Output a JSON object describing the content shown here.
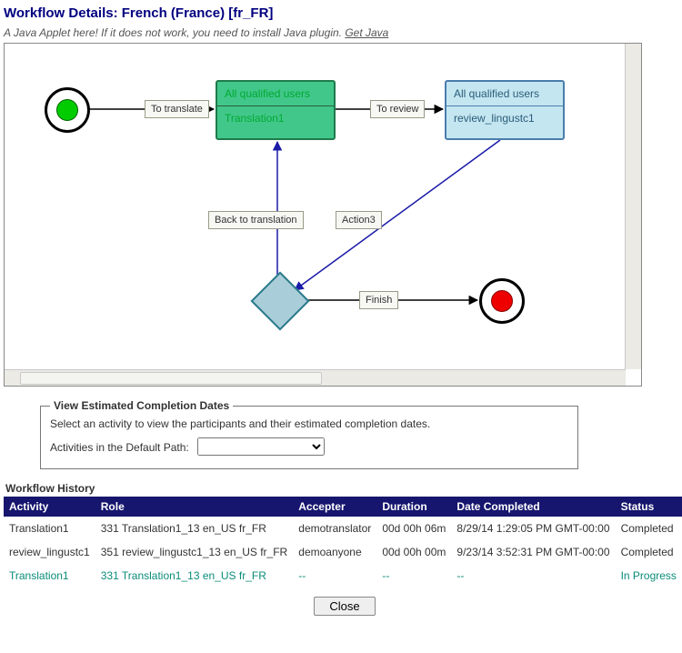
{
  "title": "Workflow Details: French (France) [fr_FR]",
  "applet_note": "A Java Applet here! If it does not work, you need to install Java plugin. ",
  "get_java": "Get Java",
  "diagram": {
    "task_translate": {
      "top": "All qualified users",
      "bot": "Translation1"
    },
    "task_review": {
      "top": "All qualified users",
      "bot": "review_lingustc1"
    },
    "labels": {
      "to_translate": "To translate",
      "to_review": "To review",
      "back_to_translation": "Back to translation",
      "action3": "Action3",
      "finish": "Finish"
    }
  },
  "estimate": {
    "legend": "View Estimated Completion Dates",
    "text": "Select an activity to view the participants and their estimated completion dates.",
    "label": "Activities in the Default Path:"
  },
  "history_title": "Workflow History",
  "history_headers": [
    "Activity",
    "Role",
    "Accepter",
    "Duration",
    "Date Completed",
    "Status"
  ],
  "history_rows": [
    {
      "activity": "Translation1",
      "role": "331 Translation1_13 en_US fr_FR",
      "accepter": "demotranslator",
      "duration": "00d 00h 06m",
      "date": "8/29/14 1:29:05 PM GMT-00:00",
      "status": "Completed",
      "inprog": false
    },
    {
      "activity": "review_lingustc1",
      "role": "351 review_lingustc1_13 en_US fr_FR",
      "accepter": "demoanyone",
      "duration": "00d 00h 00m",
      "date": "9/23/14 3:52:31 PM GMT-00:00",
      "status": "Completed",
      "inprog": false
    },
    {
      "activity": "Translation1",
      "role": "331 Translation1_13 en_US fr_FR",
      "accepter": "--",
      "duration": "--",
      "date": "--",
      "status": "In Progress",
      "inprog": true
    }
  ],
  "close": "Close"
}
